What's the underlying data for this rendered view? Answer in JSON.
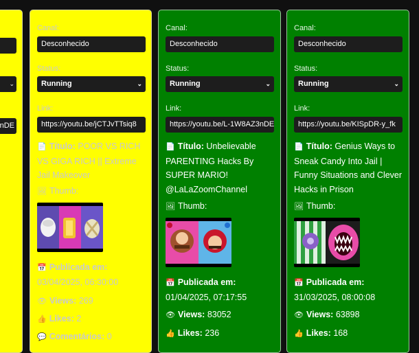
{
  "left_partial": {
    "link_fragment": "nDE",
    "chevron": "⌄"
  },
  "cards": [
    {
      "channel_label": "Canal:",
      "channel_value": "Desconhecido",
      "status_label": "Status:",
      "status_value": "Running",
      "link_label": "Link:",
      "link_value": "https://youtu.be/jCTJvTTsiq8",
      "title_label": "Título:",
      "title_value": "POOR VS RICH VS GIGA RICH || Extreme Jail Makeover",
      "thumb_label": "Thumb:",
      "published_label": "Publicada em:",
      "published_value": "03/04/2025, 06:30:00",
      "views_label": "Views:",
      "views_value": "269",
      "likes_label": "Likes:",
      "likes_value": "2",
      "comments_label": "Comentários:",
      "comments_value": "0"
    },
    {
      "channel_label": "Canal:",
      "channel_value": "Desconhecido",
      "status_label": "Status:",
      "status_value": "Running",
      "link_label": "Link:",
      "link_value": "https://youtu.be/L-1W8AZ3nDE",
      "title_label": "Título:",
      "title_value": "Unbelievable PARENTING Hacks By SUPER MARIO! @LaLaZoomChannel",
      "thumb_label": "Thumb:",
      "published_label": "Publicada em:",
      "published_value": "01/04/2025, 07:17:55",
      "views_label": "Views:",
      "views_value": "83052",
      "likes_label": "Likes:",
      "likes_value": "236"
    },
    {
      "channel_label": "Canal:",
      "channel_value": "Desconhecido",
      "status_label": "Status:",
      "status_value": "Running",
      "link_label": "Link:",
      "link_value": "https://youtu.be/KISpDR-y_fk",
      "title_label": "Título:",
      "title_value": "Genius Ways to Sneak Candy Into Jail | Funny Situations and Clever Hacks in Prison",
      "thumb_label": "Thumb:",
      "published_label": "Publicada em:",
      "published_value": "31/03/2025, 08:00:08",
      "views_label": "Views:",
      "views_value": "63898",
      "likes_label": "Likes:",
      "likes_value": "168"
    }
  ],
  "icons": {
    "title": "document-icon",
    "thumb": "image-icon",
    "published": "calendar-icon",
    "views": "eye-icon",
    "likes": "thumbs-up-icon",
    "comments": "speech-bubble-icon"
  },
  "colors": {
    "yellow_card": "#ffff00",
    "green_card": "#008000",
    "field_bg": "#1d1d1d",
    "page_bg": "#101010"
  }
}
